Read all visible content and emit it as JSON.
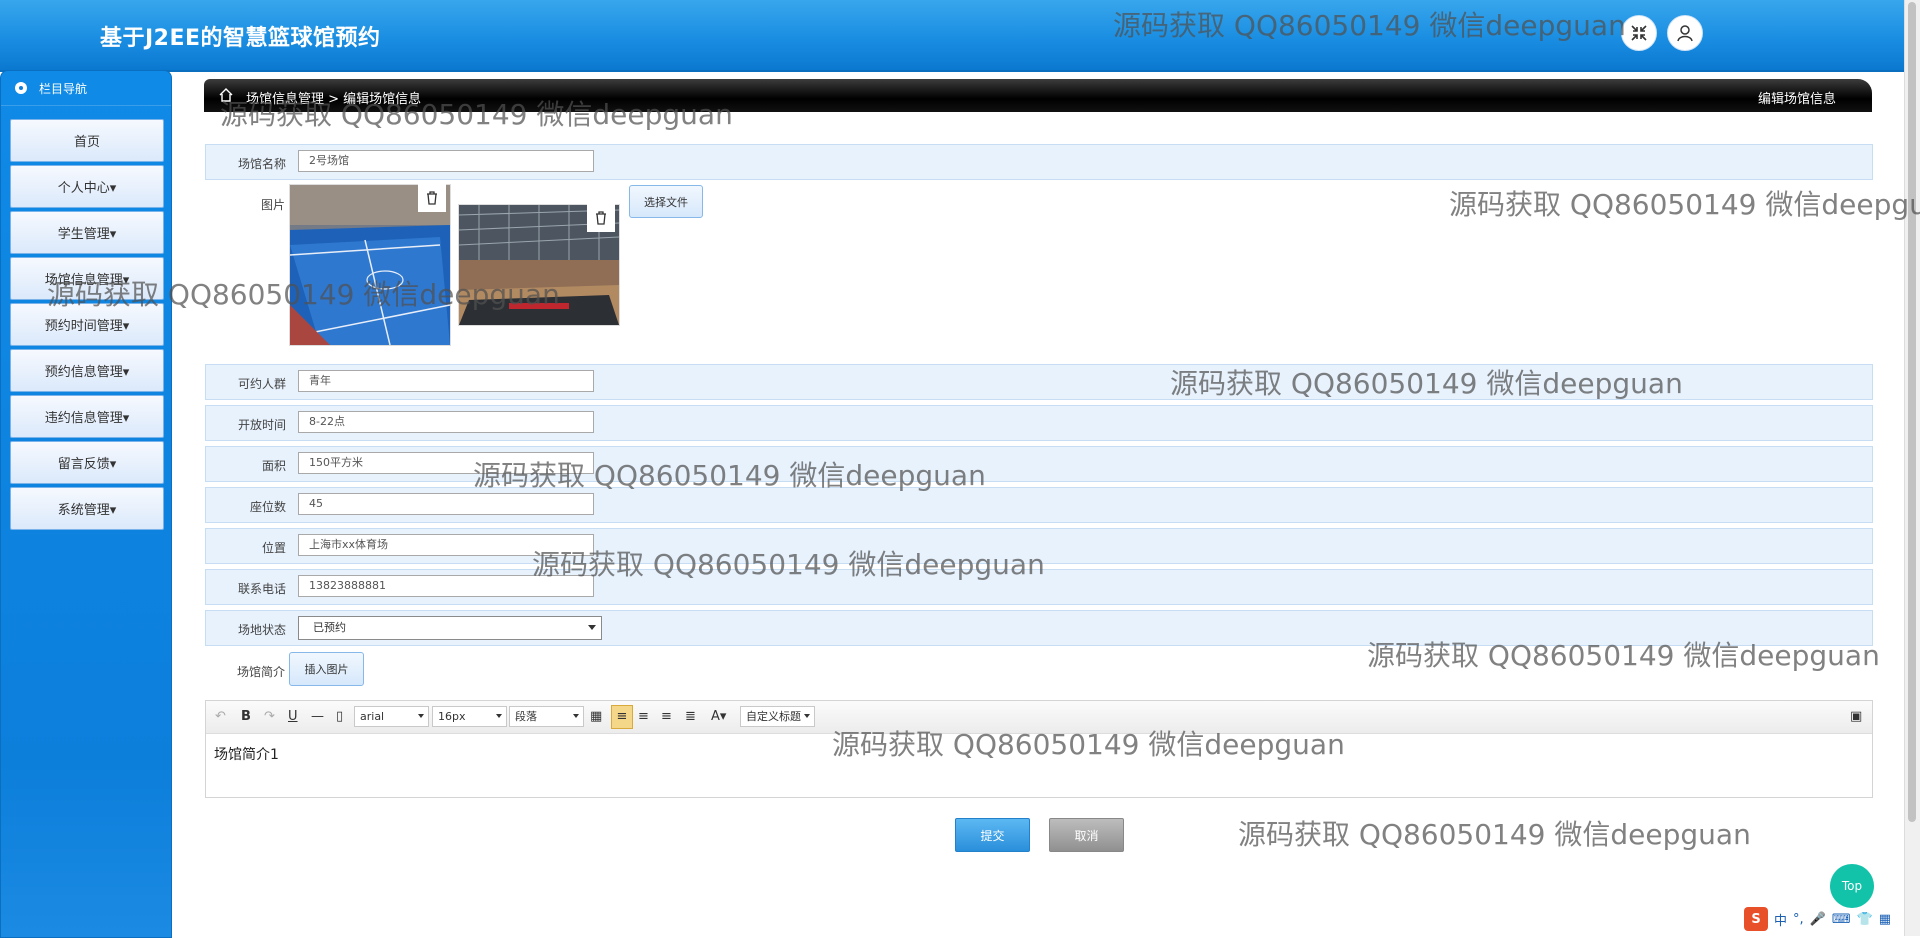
{
  "header": {
    "title": "基于J2EE的智慧篮球馆预约",
    "fullscreen_icon": "fullscreen-exit-icon",
    "user_icon": "user-icon"
  },
  "sidebar": {
    "heading": "栏目导航",
    "items": [
      {
        "label": "首页"
      },
      {
        "label": "个人中心▾"
      },
      {
        "label": "学生管理▾"
      },
      {
        "label": "场馆信息管理▾"
      },
      {
        "label": "预约时间管理▾"
      },
      {
        "label": "预约信息管理▾"
      },
      {
        "label": "违约信息管理▾"
      },
      {
        "label": "留言反馈▾"
      },
      {
        "label": "系统管理▾"
      }
    ]
  },
  "breadcrumb": {
    "path": "场馆信息管理 > 编辑场馆信息",
    "page_title": "编辑场馆信息"
  },
  "form": {
    "name": {
      "label": "场馆名称",
      "value": "2号场馆"
    },
    "images": {
      "label": "图片",
      "choose_button": "选择文件"
    },
    "audience": {
      "label": "可约人群",
      "value": "青年"
    },
    "open_time": {
      "label": "开放时间",
      "value": "8-22点"
    },
    "area": {
      "label": "面积",
      "value": "150平方米"
    },
    "seats": {
      "label": "座位数",
      "value": "45"
    },
    "location": {
      "label": "位置",
      "value": "上海市xx体育场"
    },
    "phone": {
      "label": "联系电话",
      "value": "13823888881"
    },
    "status": {
      "label": "场地状态",
      "value": "已预约"
    },
    "intro": {
      "label": "场馆简介",
      "insert_button": "插入图片"
    }
  },
  "editor": {
    "font_family": "arial",
    "font_size": "16px",
    "paragraph": "段落",
    "custom_title": "自定义标题",
    "content": "场馆简介1"
  },
  "actions": {
    "submit": "提交",
    "cancel": "取消",
    "top": "Top"
  },
  "watermark": "源码获取 QQ86050149 微信deepguan",
  "ime": {
    "logo": "S",
    "lang": "中",
    "punct": "°,"
  },
  "colors": {
    "header_blue": "#1a8ee2",
    "sidebar_blue": "#0c7fdb",
    "row_bg": "#e8f2fd",
    "submit": "#2a8fdb",
    "top_button": "#12c2a9"
  }
}
